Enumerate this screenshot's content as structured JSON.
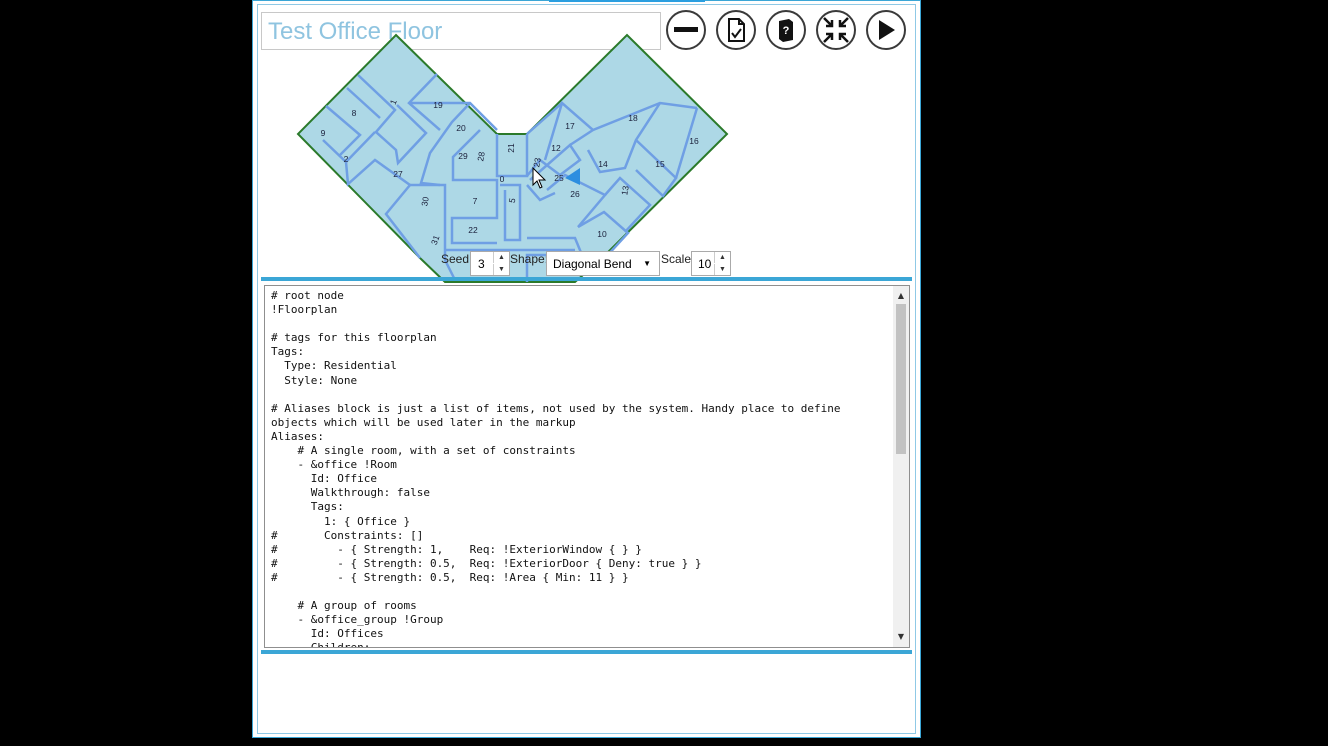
{
  "window": {
    "title": "Test Office Floor"
  },
  "toolbar": [
    {
      "name": "remove-button",
      "icon": "minus-icon"
    },
    {
      "name": "validate-button",
      "icon": "document-check-icon"
    },
    {
      "name": "help-button",
      "icon": "book-question-icon"
    },
    {
      "name": "collapse-button",
      "icon": "compress-arrows-icon"
    },
    {
      "name": "run-button",
      "icon": "play-icon"
    }
  ],
  "controls": {
    "seed_label": "Seed:",
    "seed_value": "3",
    "shape_label": "Shape:",
    "shape_value": "Diagonal Bend",
    "scale_label": "Scale:",
    "scale_value": "10"
  },
  "floorplan": {
    "room_labels": [
      "1",
      "8",
      "9",
      "19",
      "20",
      "2",
      "27",
      "29",
      "28",
      "21",
      "23",
      "0",
      "30",
      "7",
      "5",
      "22",
      "31",
      "17",
      "12",
      "18",
      "14",
      "15",
      "16",
      "26",
      "13",
      "10",
      "25"
    ],
    "colors": {
      "room_fill": "#add8e6",
      "room_stroke": "#6f9fe4",
      "outline": "#2b7a2b",
      "courtyard": "#fff5dc"
    }
  },
  "editor": {
    "lines": [
      "# root node",
      "!Floorplan",
      "",
      "# tags for this floorplan",
      "Tags:",
      "  Type: Residential",
      "  Style: None",
      "",
      "# Aliases block is just a list of items, not used by the system. Handy place to define",
      "objects which will be used later in the markup",
      "Aliases:",
      "    # A single room, with a set of constraints",
      "    - &office !Room",
      "      Id: Office",
      "      Walkthrough: false",
      "      Tags:",
      "        1: { Office }",
      "#       Constraints: []",
      "#         - { Strength: 1,    Req: !ExteriorWindow { } }",
      "#         - { Strength: 0.5,  Req: !ExteriorDoor { Deny: true } }",
      "#         - { Strength: 0.5,  Req: !Area { Min: 11 } }",
      "",
      "    # A group of rooms",
      "    - &office_group !Group",
      "      Id: Offices",
      "      Children:"
    ]
  }
}
